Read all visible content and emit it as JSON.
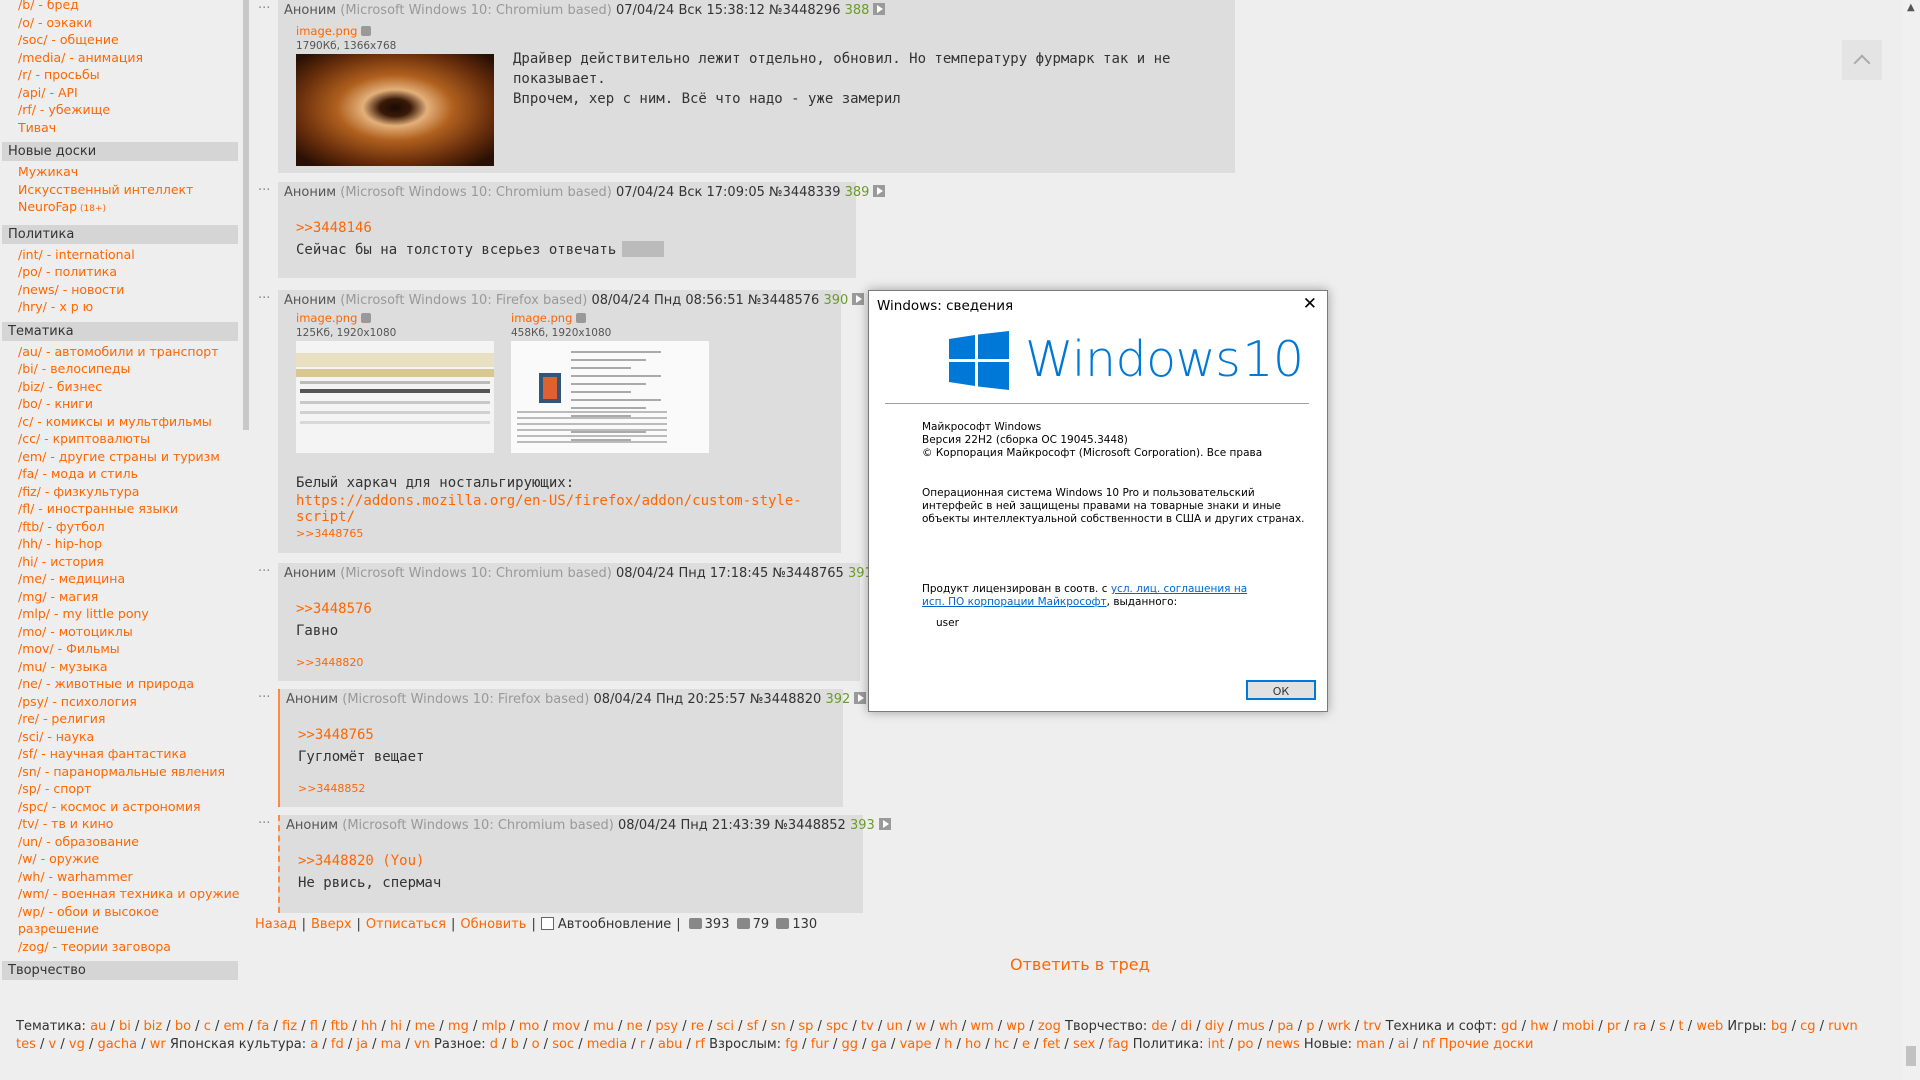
{
  "sidebar": {
    "top_items": [
      "/b/ - бред",
      "/o/ - оэкаки",
      "/soc/ - общение",
      "/media/ - анимация",
      "/r/ - просьбы",
      "/api/ - API",
      "/rf/ - убежище",
      "Тивач"
    ],
    "sections": [
      {
        "title": "Новые доски",
        "items": [
          {
            "label": "Мужикач"
          },
          {
            "label": "Искусственный интеллект"
          },
          {
            "label": "NeuroFap",
            "tag": "(18+)"
          }
        ]
      },
      {
        "title": "Политика",
        "items": [
          {
            "label": "/int/ - international"
          },
          {
            "label": "/po/ - политика"
          },
          {
            "label": "/news/ - новости"
          },
          {
            "label": "/hry/ - х р ю"
          }
        ]
      },
      {
        "title": "Тематика",
        "items": [
          {
            "label": "/au/ - автомобили и транспорт"
          },
          {
            "label": "/bi/ - велосипеды"
          },
          {
            "label": "/biz/ - бизнес"
          },
          {
            "label": "/bo/ - книги"
          },
          {
            "label": "/c/ - комиксы и мультфильмы"
          },
          {
            "label": "/cc/ - криптовалюты"
          },
          {
            "label": "/em/ - другие страны и туризм"
          },
          {
            "label": "/fa/ - мода и стиль"
          },
          {
            "label": "/fiz/ - физкультура"
          },
          {
            "label": "/fl/ - иностранные языки"
          },
          {
            "label": "/ftb/ - футбол"
          },
          {
            "label": "/hh/ - hip-hop"
          },
          {
            "label": "/hi/ - история"
          },
          {
            "label": "/me/ - медицина"
          },
          {
            "label": "/mg/ - магия"
          },
          {
            "label": "/mlp/ - my little pony"
          },
          {
            "label": "/mo/ - мотоциклы"
          },
          {
            "label": "/mov/ - Фильмы"
          },
          {
            "label": "/mu/ - музыка"
          },
          {
            "label": "/ne/ - животные и природа"
          },
          {
            "label": "/psy/ - психология"
          },
          {
            "label": "/re/ - религия"
          },
          {
            "label": "/sci/ - наука"
          },
          {
            "label": "/sf/ - научная фантастика"
          },
          {
            "label": "/sn/ - паранормальные явления"
          },
          {
            "label": "/sp/ - спорт"
          },
          {
            "label": "/spc/ - космос и астрономия"
          },
          {
            "label": "/tv/ - тв и кино"
          },
          {
            "label": "/un/ - образование"
          },
          {
            "label": "/w/ - оружие"
          },
          {
            "label": "/wh/ - warhammer"
          },
          {
            "label": "/wm/ - военная техника и оружие"
          },
          {
            "label": "/wp/ - обои и высокое разрешение"
          },
          {
            "label": "/zog/ - теории заговора"
          }
        ]
      },
      {
        "title": "Творчество",
        "items": []
      }
    ]
  },
  "posts": [
    {
      "name": "Аноним",
      "ua": "(Microsoft Windows 10: Chromium based)",
      "date": "07/04/24 Вск 15:38:12",
      "num": "№3448296",
      "cnt": "388",
      "files": [
        {
          "name": "image.png",
          "meta": "1790Кб, 1366x768"
        }
      ],
      "text": [
        "Драйвер действительно лежит отдельно, обновил. Но температуру фурмарк так и не показывает.",
        "Впрочем, хер с ним. Всё что надо - уже замерил"
      ]
    },
    {
      "name": "Аноним",
      "ua": "(Microsoft Windows 10: Chromium based)",
      "date": "07/04/24 Вск 17:09:05",
      "num": "№3448339",
      "cnt": "389",
      "reply": ">>3448146",
      "text": [
        "Сейчас бы на толстоту всерьез отвечать"
      ]
    },
    {
      "name": "Аноним",
      "ua": "(Microsoft Windows 10: Firefox based)",
      "date": "08/04/24 Пнд 08:56:51",
      "num": "№3448576",
      "cnt": "390",
      "files": [
        {
          "name": "image.png",
          "meta": "125Кб, 1920x1080"
        },
        {
          "name": "image.png",
          "meta": "458Кб, 1920x1080"
        }
      ],
      "text": [
        "Белый харкач для ностальгирующих:"
      ],
      "link": "https://addons.mozilla.org/en-US/firefox/addon/custom-style-script/",
      "backref": ">>3448765"
    },
    {
      "name": "Аноним",
      "ua": "(Microsoft Windows 10: Chromium based)",
      "date": "08/04/24 Пнд 17:18:45",
      "num": "№3448765",
      "cnt": "391",
      "reply": ">>3448576",
      "text": [
        "Гавно"
      ],
      "backref": ">>3448820"
    },
    {
      "name": "Аноним",
      "ua": "(Microsoft Windows 10: Firefox based)",
      "date": "08/04/24 Пнд 20:25:57",
      "num": "№3448820",
      "cnt": "392",
      "reply": ">>3448765",
      "text": [
        "Гугломёт вещает"
      ],
      "backref": ">>3448852"
    },
    {
      "name": "Аноним",
      "ua": "(Microsoft Windows 10: Chromium based)",
      "date": "08/04/24 Пнд 21:43:39",
      "num": "№3448852",
      "cnt": "393",
      "reply": ">>3448820 (You)",
      "text": [
        "Не рвись, спермач"
      ]
    }
  ],
  "thread_nav": {
    "back": "Назад",
    "up": "Вверх",
    "unsubscribe": "Отписаться",
    "refresh": "Обновить",
    "autoupdate": "Автообновление",
    "posts": "393",
    "files": "79",
    "posters": "130"
  },
  "reply_button": "Ответить в тред",
  "footer": {
    "line1": [
      {
        "cat": "Тематика:",
        "boards": [
          "au",
          "bi",
          "biz",
          "bo",
          "c",
          "em",
          "fa",
          "fiz",
          "fl",
          "ftb",
          "hh",
          "hi",
          "me",
          "mg",
          "mlp",
          "mo",
          "mov",
          "mu",
          "ne",
          "psy",
          "re",
          "sci",
          "sf",
          "sn",
          "sp",
          "spc",
          "tv",
          "un",
          "w",
          "wh",
          "wm",
          "wp",
          "zog"
        ]
      },
      {
        "cat": "Творчество:",
        "boards": [
          "de",
          "di",
          "diy",
          "mus",
          "pa",
          "p",
          "wrk",
          "trv"
        ]
      },
      {
        "cat": "Техника и софт:",
        "boards": [
          "gd",
          "hw",
          "mobi",
          "pr",
          "ra",
          "s",
          "t",
          "web"
        ]
      },
      {
        "cat": "Игры:",
        "boards": [
          "bg",
          "cg",
          "ruvn"
        ]
      }
    ],
    "line2": [
      {
        "cat": "",
        "boards": [
          "tes",
          "v",
          "vg",
          "gacha",
          "wr"
        ]
      },
      {
        "cat": "Японская культура:",
        "boards": [
          "a",
          "fd",
          "ja",
          "ma",
          "vn"
        ]
      },
      {
        "cat": "Разное:",
        "boards": [
          "d",
          "b",
          "o",
          "soc",
          "media",
          "r",
          "abu",
          "rf"
        ]
      },
      {
        "cat": "Взрослым:",
        "boards": [
          "fg",
          "fur",
          "gg",
          "ga",
          "vape",
          "h",
          "ho",
          "hc",
          "e",
          "fet",
          "sex",
          "fag"
        ]
      },
      {
        "cat": "Политика:",
        "boards": [
          "int",
          "po",
          "news"
        ]
      },
      {
        "cat": "Новые:",
        "boards": [
          "man",
          "ai",
          "nf"
        ]
      }
    ],
    "other": "Прочие доски"
  },
  "dialog": {
    "title": "Windows: сведения",
    "product": "Windows",
    "version_num": "10",
    "line1": "Майкрософт Windows",
    "line2": "Версия 22H2 (сборка ОС 19045.3448)",
    "line3": "© Корпорация Майкрософт (Microsoft Corporation). Все права",
    "para1": [
      "Операционная система Windows 10 Pro и пользовательский",
      "интерфейс в ней защищены правами на товарные знаки и иные",
      "объекты интеллектуальной собственности в США и других странах."
    ],
    "license_pre": "Продукт лицензирован в соотв. с ",
    "license_link1": "усл. лиц. соглашения на",
    "license_link2": "исп. ПО корпорации Майкрософт",
    "license_post": ", выданного:",
    "user": "user",
    "ok": "ОК",
    "accent": "#0078d7"
  }
}
